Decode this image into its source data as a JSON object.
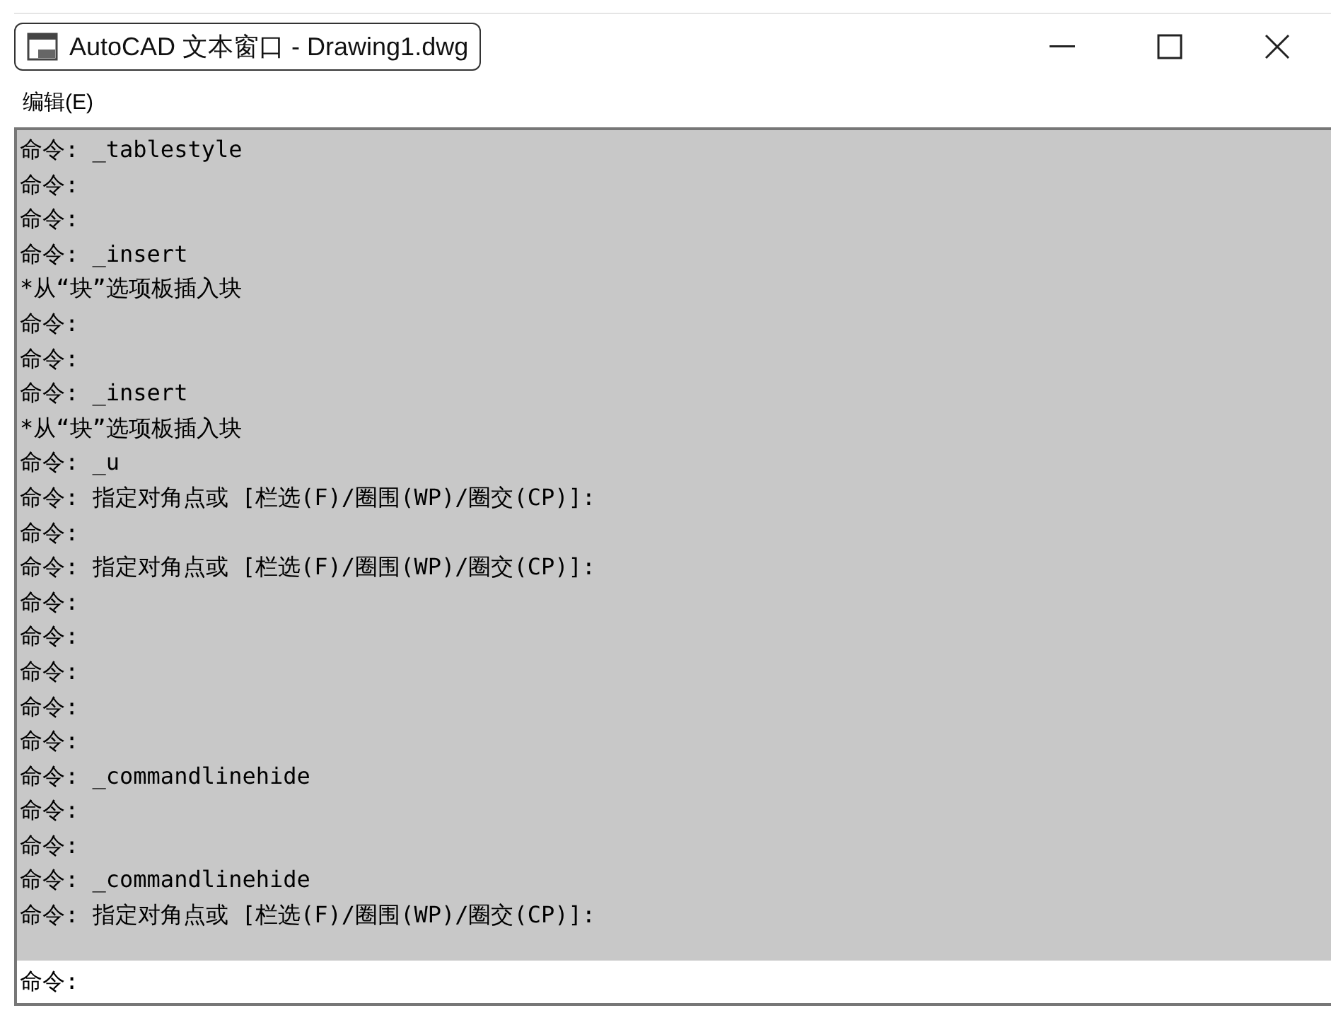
{
  "window": {
    "title": "AutoCAD 文本窗口 - Drawing1.dwg"
  },
  "menu_bar": [
    {
      "label": "编辑(E)"
    }
  ],
  "history": [
    "命令: _tablestyle",
    "命令:",
    "命令:",
    "命令: _insert",
    "*从“块”选项板插入块",
    "命令:",
    "命令:",
    "命令: _insert",
    "*从“块”选项板插入块",
    "命令: _u",
    "命令: 指定对角点或 [栏选(F)/圈围(WP)/圈交(CP)]:",
    "命令:",
    "命令: 指定对角点或 [栏选(F)/圈围(WP)/圈交(CP)]:",
    "命令:",
    "命令:",
    "命令:",
    "命令:",
    "命令:",
    "命令: _commandlinehide",
    "命令:",
    "命令:",
    "命令: _commandlinehide",
    "命令: 指定对角点或 [栏选(F)/圈围(WP)/圈交(CP)]:"
  ],
  "command_line": {
    "prompt": "命令:"
  }
}
